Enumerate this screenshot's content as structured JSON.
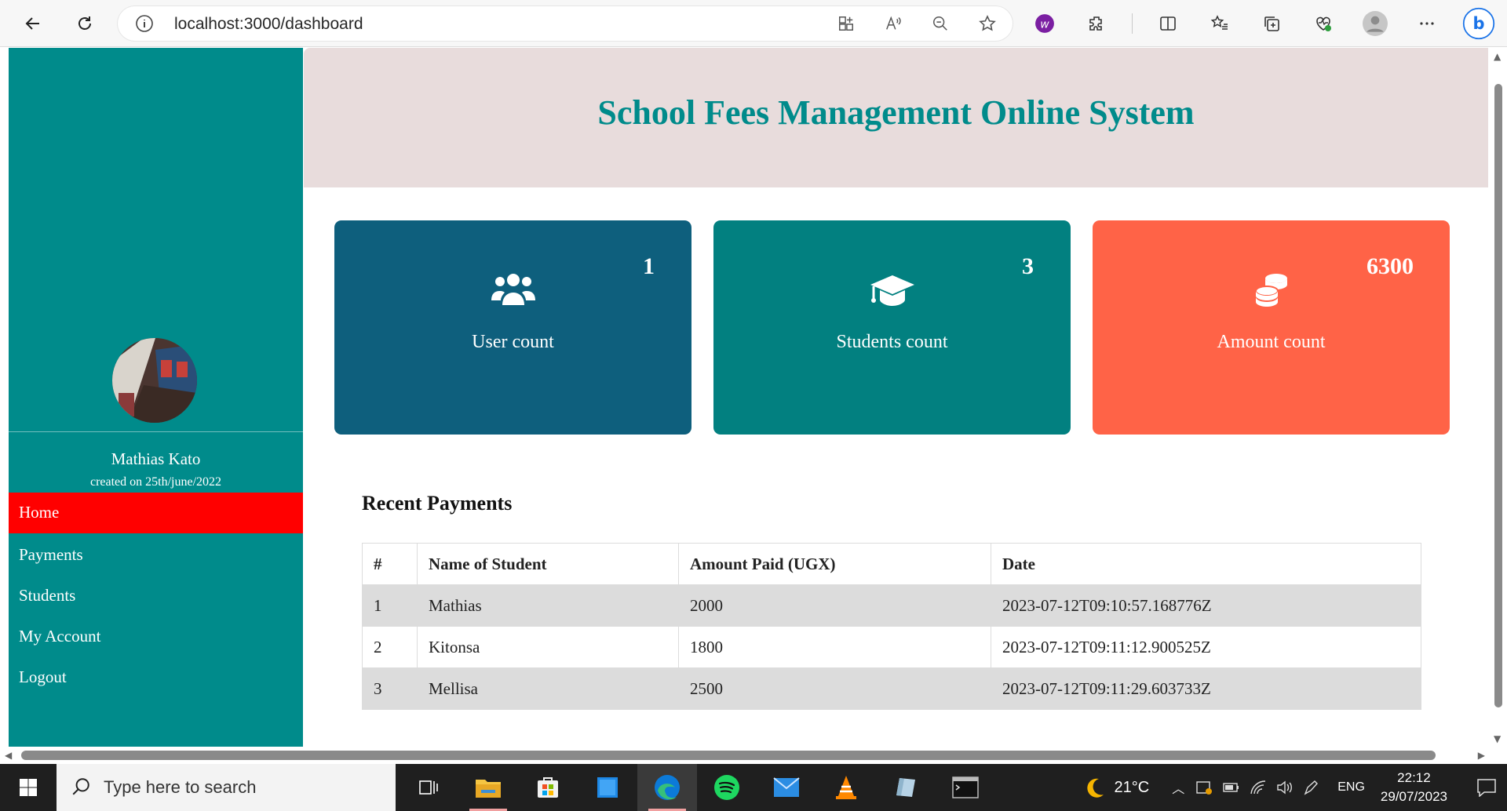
{
  "browser": {
    "url": "localhost:3000/dashboard"
  },
  "sidebar": {
    "user_name": "Mathias Kato",
    "created": "created on 25th/june/2022",
    "nav": [
      {
        "label": "Home",
        "active": true
      },
      {
        "label": "Payments"
      },
      {
        "label": "Students"
      },
      {
        "label": "My Account"
      },
      {
        "label": "Logout"
      }
    ]
  },
  "header": {
    "title": "School Fees Management Online System"
  },
  "cards": [
    {
      "label": "User count",
      "value": "1",
      "icon": "users-icon",
      "color": "#0e5f7d"
    },
    {
      "label": "Students count",
      "value": "3",
      "icon": "graduation-cap-icon",
      "color": "#028080"
    },
    {
      "label": "Amount count",
      "value": "6300",
      "icon": "coins-icon",
      "color": "#ff6347"
    }
  ],
  "payments": {
    "title": "Recent Payments",
    "columns": [
      "#",
      "Name of Student",
      "Amount Paid (UGX)",
      "Date"
    ],
    "rows": [
      [
        "1",
        "Mathias",
        "2000",
        "2023-07-12T09:10:57.168776Z"
      ],
      [
        "2",
        "Kitonsa",
        "1800",
        "2023-07-12T09:11:12.900525Z"
      ],
      [
        "3",
        "Mellisa",
        "2500",
        "2023-07-12T09:11:29.603733Z"
      ]
    ]
  },
  "taskbar": {
    "search_placeholder": "Type here to search",
    "temperature": "21°C",
    "language": "ENG",
    "time": "22:12",
    "date": "29/07/2023"
  }
}
